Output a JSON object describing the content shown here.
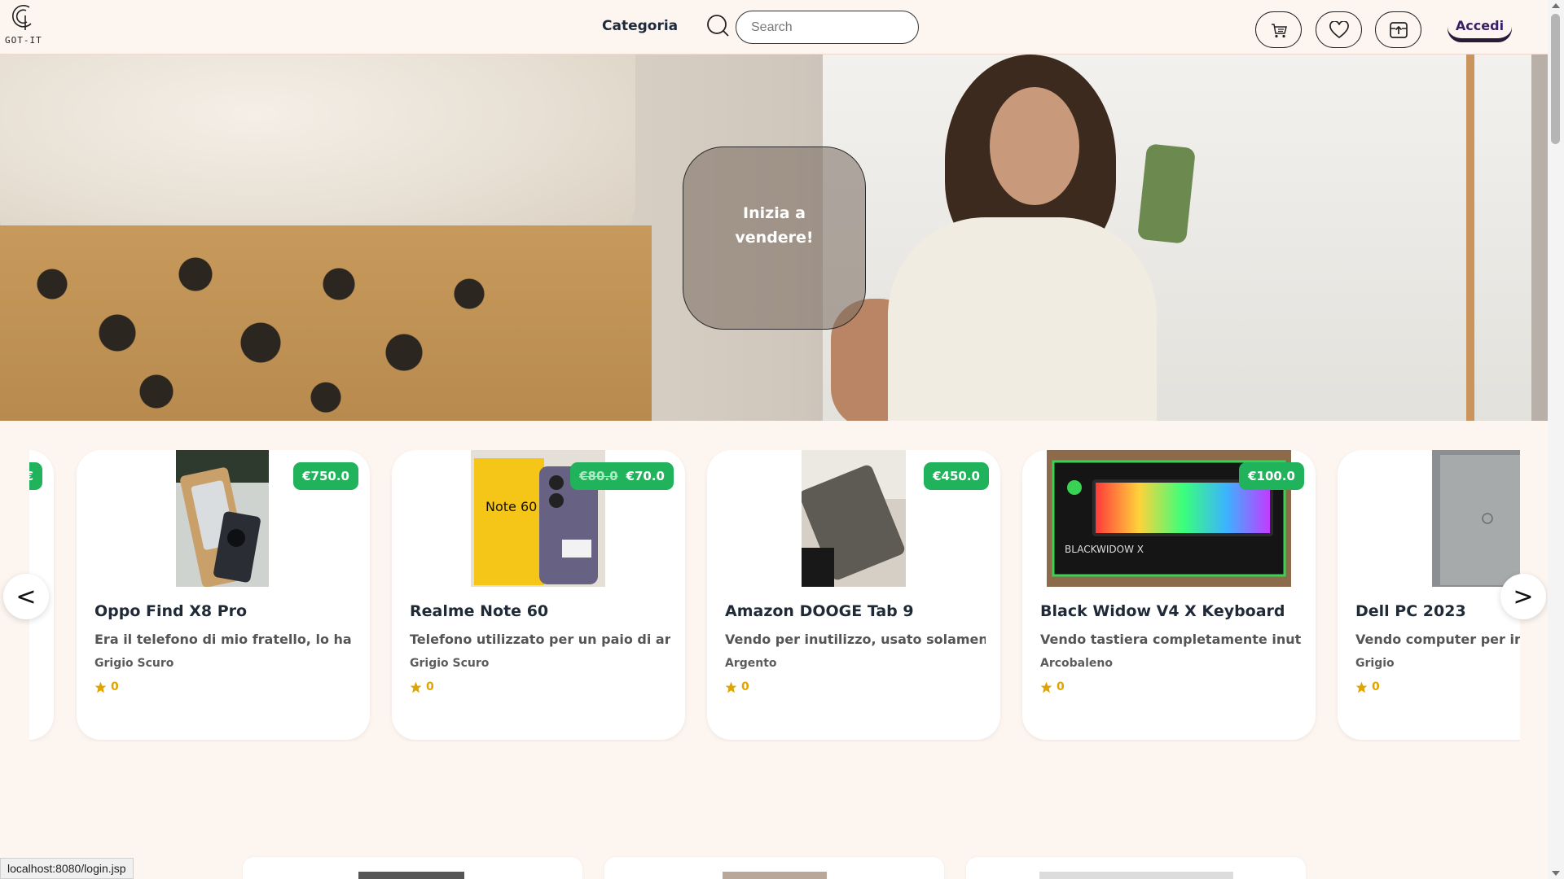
{
  "header": {
    "logo_text": "GOT-IT",
    "nav_category": "Categoria",
    "search_placeholder": "Search",
    "login_label": "Accedi",
    "icons": [
      "cart-icon",
      "heart-icon",
      "sell-upload-icon",
      "search-icon"
    ]
  },
  "hero": {
    "cta_line1": "Inizia a",
    "cta_line2": "vendere!"
  },
  "carousel": {
    "prev_label": "<",
    "next_label": ">",
    "partial_left": {
      "price": "€",
      "desc_fragment": "."
    },
    "items": [
      {
        "title": "Oppo Find X8 Pro",
        "description": "Era il telefono di mio fratello, lo ha tr...",
        "color": "Grigio Scuro",
        "rating": "0",
        "price": "€750.0",
        "old_price": ""
      },
      {
        "title": "Realme Note 60",
        "description": "Telefono utilizzato per un paio di an...",
        "color": "Grigio Scuro",
        "rating": "0",
        "price": "€70.0",
        "old_price": "€80.0"
      },
      {
        "title": "Amazon DOOGE Tab 9",
        "description": "Vendo per inutilizzo, usato solament...",
        "color": "Argento",
        "rating": "0",
        "price": "€450.0",
        "old_price": ""
      },
      {
        "title": "Black Widow V4 X Keyboard",
        "description": "Vendo tastiera completamente inutili...",
        "color": "Arcobaleno",
        "rating": "0",
        "price": "€100.0",
        "old_price": ""
      },
      {
        "title": "Dell PC 2023",
        "description": "Vendo computer per inut",
        "color": "Grigio",
        "rating": "0",
        "price": "",
        "old_price": ""
      }
    ]
  },
  "status_bar": {
    "url": "localhost:8080/login.jsp"
  },
  "colors": {
    "background": "#fdf5f0",
    "price_badge": "#21b35c",
    "login_text": "#3a1f66",
    "star": "#e0a300"
  }
}
